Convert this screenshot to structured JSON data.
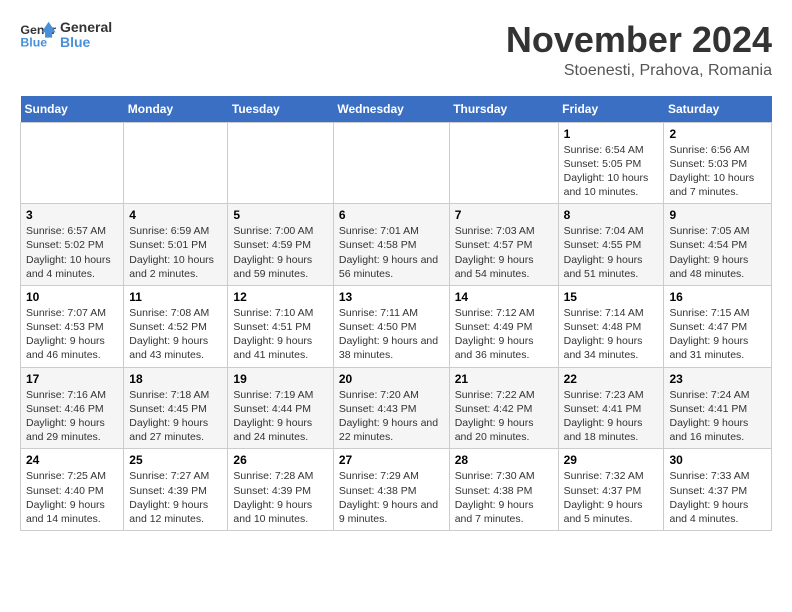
{
  "logo": {
    "line1": "General",
    "line2": "Blue"
  },
  "title": "November 2024",
  "location": "Stoenesti, Prahova, Romania",
  "days_of_week": [
    "Sunday",
    "Monday",
    "Tuesday",
    "Wednesday",
    "Thursday",
    "Friday",
    "Saturday"
  ],
  "weeks": [
    [
      {
        "day": "",
        "info": ""
      },
      {
        "day": "",
        "info": ""
      },
      {
        "day": "",
        "info": ""
      },
      {
        "day": "",
        "info": ""
      },
      {
        "day": "",
        "info": ""
      },
      {
        "day": "1",
        "info": "Sunrise: 6:54 AM\nSunset: 5:05 PM\nDaylight: 10 hours and 10 minutes."
      },
      {
        "day": "2",
        "info": "Sunrise: 6:56 AM\nSunset: 5:03 PM\nDaylight: 10 hours and 7 minutes."
      }
    ],
    [
      {
        "day": "3",
        "info": "Sunrise: 6:57 AM\nSunset: 5:02 PM\nDaylight: 10 hours and 4 minutes."
      },
      {
        "day": "4",
        "info": "Sunrise: 6:59 AM\nSunset: 5:01 PM\nDaylight: 10 hours and 2 minutes."
      },
      {
        "day": "5",
        "info": "Sunrise: 7:00 AM\nSunset: 4:59 PM\nDaylight: 9 hours and 59 minutes."
      },
      {
        "day": "6",
        "info": "Sunrise: 7:01 AM\nSunset: 4:58 PM\nDaylight: 9 hours and 56 minutes."
      },
      {
        "day": "7",
        "info": "Sunrise: 7:03 AM\nSunset: 4:57 PM\nDaylight: 9 hours and 54 minutes."
      },
      {
        "day": "8",
        "info": "Sunrise: 7:04 AM\nSunset: 4:55 PM\nDaylight: 9 hours and 51 minutes."
      },
      {
        "day": "9",
        "info": "Sunrise: 7:05 AM\nSunset: 4:54 PM\nDaylight: 9 hours and 48 minutes."
      }
    ],
    [
      {
        "day": "10",
        "info": "Sunrise: 7:07 AM\nSunset: 4:53 PM\nDaylight: 9 hours and 46 minutes."
      },
      {
        "day": "11",
        "info": "Sunrise: 7:08 AM\nSunset: 4:52 PM\nDaylight: 9 hours and 43 minutes."
      },
      {
        "day": "12",
        "info": "Sunrise: 7:10 AM\nSunset: 4:51 PM\nDaylight: 9 hours and 41 minutes."
      },
      {
        "day": "13",
        "info": "Sunrise: 7:11 AM\nSunset: 4:50 PM\nDaylight: 9 hours and 38 minutes."
      },
      {
        "day": "14",
        "info": "Sunrise: 7:12 AM\nSunset: 4:49 PM\nDaylight: 9 hours and 36 minutes."
      },
      {
        "day": "15",
        "info": "Sunrise: 7:14 AM\nSunset: 4:48 PM\nDaylight: 9 hours and 34 minutes."
      },
      {
        "day": "16",
        "info": "Sunrise: 7:15 AM\nSunset: 4:47 PM\nDaylight: 9 hours and 31 minutes."
      }
    ],
    [
      {
        "day": "17",
        "info": "Sunrise: 7:16 AM\nSunset: 4:46 PM\nDaylight: 9 hours and 29 minutes."
      },
      {
        "day": "18",
        "info": "Sunrise: 7:18 AM\nSunset: 4:45 PM\nDaylight: 9 hours and 27 minutes."
      },
      {
        "day": "19",
        "info": "Sunrise: 7:19 AM\nSunset: 4:44 PM\nDaylight: 9 hours and 24 minutes."
      },
      {
        "day": "20",
        "info": "Sunrise: 7:20 AM\nSunset: 4:43 PM\nDaylight: 9 hours and 22 minutes."
      },
      {
        "day": "21",
        "info": "Sunrise: 7:22 AM\nSunset: 4:42 PM\nDaylight: 9 hours and 20 minutes."
      },
      {
        "day": "22",
        "info": "Sunrise: 7:23 AM\nSunset: 4:41 PM\nDaylight: 9 hours and 18 minutes."
      },
      {
        "day": "23",
        "info": "Sunrise: 7:24 AM\nSunset: 4:41 PM\nDaylight: 9 hours and 16 minutes."
      }
    ],
    [
      {
        "day": "24",
        "info": "Sunrise: 7:25 AM\nSunset: 4:40 PM\nDaylight: 9 hours and 14 minutes."
      },
      {
        "day": "25",
        "info": "Sunrise: 7:27 AM\nSunset: 4:39 PM\nDaylight: 9 hours and 12 minutes."
      },
      {
        "day": "26",
        "info": "Sunrise: 7:28 AM\nSunset: 4:39 PM\nDaylight: 9 hours and 10 minutes."
      },
      {
        "day": "27",
        "info": "Sunrise: 7:29 AM\nSunset: 4:38 PM\nDaylight: 9 hours and 9 minutes."
      },
      {
        "day": "28",
        "info": "Sunrise: 7:30 AM\nSunset: 4:38 PM\nDaylight: 9 hours and 7 minutes."
      },
      {
        "day": "29",
        "info": "Sunrise: 7:32 AM\nSunset: 4:37 PM\nDaylight: 9 hours and 5 minutes."
      },
      {
        "day": "30",
        "info": "Sunrise: 7:33 AM\nSunset: 4:37 PM\nDaylight: 9 hours and 4 minutes."
      }
    ]
  ]
}
